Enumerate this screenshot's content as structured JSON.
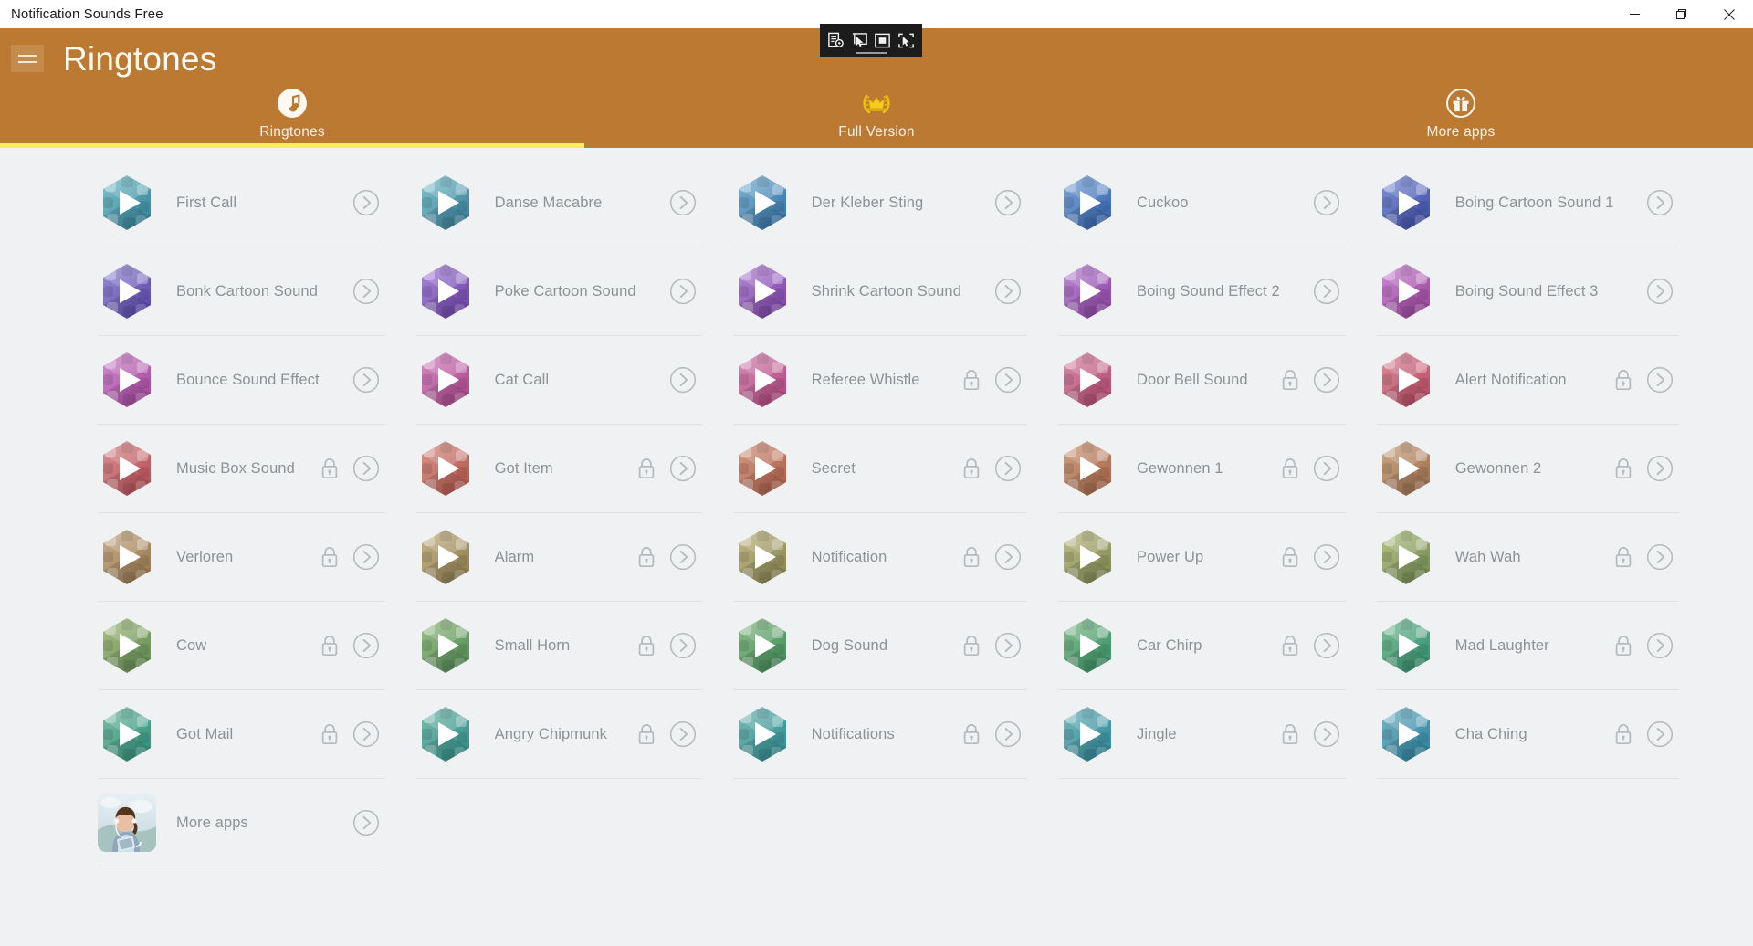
{
  "window": {
    "title": "Notification Sounds Free",
    "controls": [
      {
        "name": "minimize",
        "glyph": "minimize-icon"
      },
      {
        "name": "restore",
        "glyph": "restore-icon"
      },
      {
        "name": "close",
        "glyph": "close-icon"
      }
    ]
  },
  "overlay_toolbar": {
    "buttons": [
      {
        "name": "capture-settings-icon",
        "label": ""
      },
      {
        "name": "window-pointer-icon",
        "label": ""
      },
      {
        "name": "region-select-icon",
        "label": ""
      },
      {
        "name": "element-select-icon",
        "label": ""
      }
    ]
  },
  "header": {
    "menu_button": "hamburger-menu",
    "title": "Ringtones",
    "background_color": "#bb7931",
    "indicator_color": "#fbec5d"
  },
  "tabs": [
    {
      "label": "Ringtones",
      "icon": "music-note-icon",
      "active": true
    },
    {
      "label": "Full Version",
      "icon": "crown-laurel-icon",
      "active": false
    },
    {
      "label": "More apps",
      "icon": "gift-box-icon",
      "active": false
    }
  ],
  "list": {
    "columns": 5,
    "items": [
      {
        "label": "First Call",
        "locked": false,
        "c1": "#7fc4cc",
        "c2": "#2f7f98"
      },
      {
        "label": "Danse Macabre",
        "locked": false,
        "c1": "#84c5cd",
        "c2": "#2f7a9a"
      },
      {
        "label": "Der Kleber Sting",
        "locked": false,
        "c1": "#7fb6d2",
        "c2": "#2f6ea6"
      },
      {
        "label": "Cuckoo",
        "locked": false,
        "c1": "#7fa8d6",
        "c2": "#2f5fae"
      },
      {
        "label": "Boing Cartoon Sound 1",
        "locked": false,
        "c1": "#8091d4",
        "c2": "#3a4aa8"
      },
      {
        "label": "Bonk Cartoon Sound",
        "locked": false,
        "c1": "#9a8ed6",
        "c2": "#5642a8"
      },
      {
        "label": "Poke Cartoon Sound",
        "locked": false,
        "c1": "#a889d8",
        "c2": "#6a3ea8"
      },
      {
        "label": "Shrink Cartoon Sound",
        "locked": false,
        "c1": "#b389d6",
        "c2": "#7b3ea4"
      },
      {
        "label": "Boing Sound Effect 2",
        "locked": false,
        "c1": "#bd8ad6",
        "c2": "#8b3fa2"
      },
      {
        "label": "Boing Sound Effect 3",
        "locked": false,
        "c1": "#c78ad2",
        "c2": "#9c3f9c"
      },
      {
        "label": "Bounce Sound Effect",
        "locked": false,
        "c1": "#cd8ccd",
        "c2": "#a4419a"
      },
      {
        "label": "Cat Call",
        "locked": false,
        "c1": "#d28bc3",
        "c2": "#ab4189"
      },
      {
        "label": "Referee Whistle",
        "locked": true,
        "c1": "#d58cb6",
        "c2": "#b0427c"
      },
      {
        "label": "Door Bell Sound",
        "locked": true,
        "c1": "#d78da9",
        "c2": "#b4446d"
      },
      {
        "label": "Alert Notification",
        "locked": true,
        "c1": "#d88d9b",
        "c2": "#b8455f"
      },
      {
        "label": "Music Box Sound",
        "locked": true,
        "c1": "#d79091",
        "c2": "#b64a52"
      },
      {
        "label": "Got Item",
        "locked": true,
        "c1": "#d59488",
        "c2": "#b45249"
      },
      {
        "label": "Secret",
        "locked": true,
        "c1": "#d29a84",
        "c2": "#ad5a44"
      },
      {
        "label": "Gewonnen 1",
        "locked": true,
        "c1": "#cfa083",
        "c2": "#a66345"
      },
      {
        "label": "Gewonnen 2",
        "locked": true,
        "c1": "#cba786",
        "c2": "#9d6c48"
      },
      {
        "label": "Verloren",
        "locked": true,
        "c1": "#c9ad89",
        "c2": "#95744b"
      },
      {
        "label": "Alarm",
        "locked": true,
        "c1": "#c5b389",
        "c2": "#8c7c4c"
      },
      {
        "label": "Notification",
        "locked": true,
        "c1": "#c2b889",
        "c2": "#85824e"
      },
      {
        "label": "Power Up",
        "locked": true,
        "c1": "#bfbd88",
        "c2": "#7d8750"
      },
      {
        "label": "Wah Wah",
        "locked": true,
        "c1": "#b6c086",
        "c2": "#6f8a4f"
      },
      {
        "label": "Cow",
        "locked": true,
        "c1": "#a9bf85",
        "c2": "#5f8a50"
      },
      {
        "label": "Small Horn",
        "locked": true,
        "c1": "#9bbe86",
        "c2": "#4f8a53"
      },
      {
        "label": "Dog Sound",
        "locked": true,
        "c1": "#8dbd88",
        "c2": "#3f8a58"
      },
      {
        "label": "Car Chirp",
        "locked": true,
        "c1": "#84bd8e",
        "c2": "#359065"
      },
      {
        "label": "Mad Laughter",
        "locked": true,
        "c1": "#7dbd97",
        "c2": "#2e906f"
      },
      {
        "label": "Got Mail",
        "locked": true,
        "c1": "#7cbda2",
        "c2": "#2c8f7c"
      },
      {
        "label": "Angry Chipmunk",
        "locked": true,
        "c1": "#7bbcac",
        "c2": "#2b8d88"
      },
      {
        "label": "Notifications",
        "locked": true,
        "c1": "#7abab4",
        "c2": "#2a8a91"
      },
      {
        "label": "Jingle",
        "locked": true,
        "c1": "#79b8bc",
        "c2": "#29869a"
      },
      {
        "label": "Cha Ching",
        "locked": true,
        "c1": "#78b5c3",
        "c2": "#2881a1"
      }
    ],
    "more_apps": {
      "label": "More apps",
      "icon": "photo-thumbnail"
    }
  },
  "colors": {
    "content_background": "#eff1f2",
    "label_text": "#8d9295",
    "divider": "#dfe2e4",
    "icon_outline": "#b5babd"
  }
}
